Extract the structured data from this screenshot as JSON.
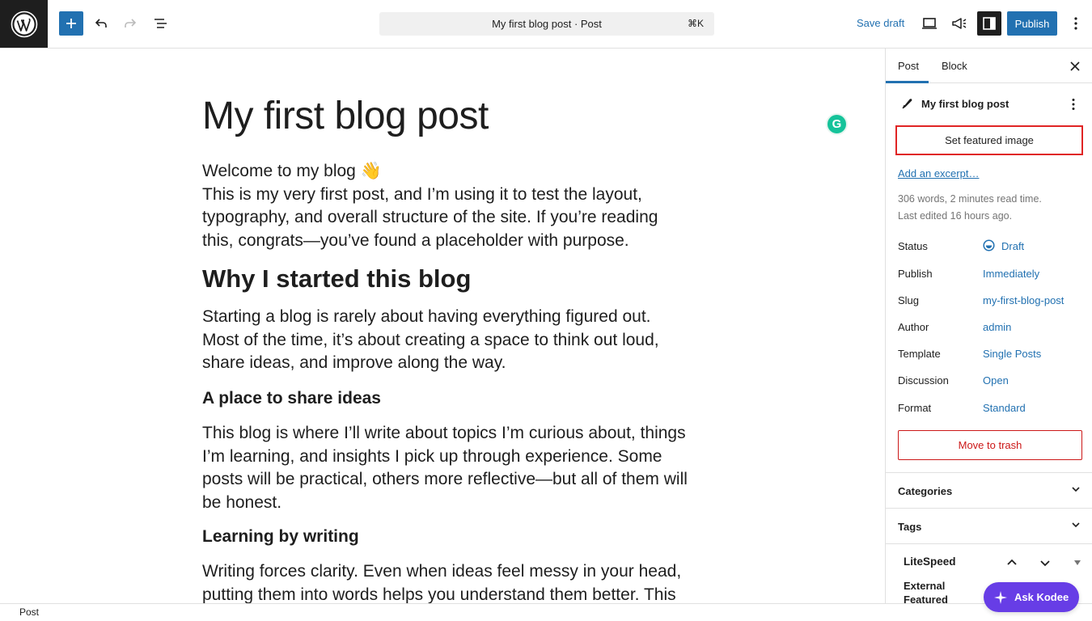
{
  "toolbar": {
    "command_title": "My first blog post · Post",
    "command_shortcut": "⌘K",
    "save_draft": "Save draft",
    "publish": "Publish"
  },
  "post": {
    "title": "My first blog post",
    "p1_line1": "Welcome to my blog 👋",
    "p1_line2": "This is my very first post, and I’m using it to test the layout, typography, and overall structure of the site. If you’re reading this, congrats—you’ve found a placeholder with purpose.",
    "h2": "Why I started this blog",
    "p2": "Starting a blog is rarely about having everything figured out. Most of the time, it’s about creating a space to think out loud, share ideas, and improve along the way.",
    "h3a": "A place to share ideas",
    "p3": "This blog is where I’ll write about topics I’m curious about, things I’m learning, and insights I pick up through experience. Some posts will be practical, others more reflective—but all of them will be honest.",
    "h3b": "Learning by writing",
    "p4": "Writing forces clarity. Even when ideas feel messy in your head, putting them into words helps you understand them better. This"
  },
  "sidebar": {
    "tab_post": "Post",
    "tab_block": "Block",
    "post_name": "My first blog post",
    "featured_image": "Set featured image",
    "excerpt": "Add an excerpt…",
    "stats": "306 words, 2 minutes read time.",
    "last_edited": "Last edited 16 hours ago.",
    "rows": [
      {
        "label": "Status",
        "value": "Draft"
      },
      {
        "label": "Publish",
        "value": "Immediately"
      },
      {
        "label": "Slug",
        "value": "my-first-blog-post"
      },
      {
        "label": "Author",
        "value": "admin"
      },
      {
        "label": "Template",
        "value": "Single Posts"
      },
      {
        "label": "Discussion",
        "value": "Open"
      },
      {
        "label": "Format",
        "value": "Standard"
      }
    ],
    "trash": "Move to trash",
    "categories": "Categories",
    "tags": "Tags",
    "litespeed": "LiteSpeed",
    "external_featured": "External Featured"
  },
  "statusbar": {
    "label": "Post"
  },
  "kodee": {
    "label": "Ask Kodee"
  },
  "colors": {
    "accent": "#2271b1",
    "highlight": "#e02424",
    "kodee": "#673de6",
    "danger": "#cc1818"
  }
}
